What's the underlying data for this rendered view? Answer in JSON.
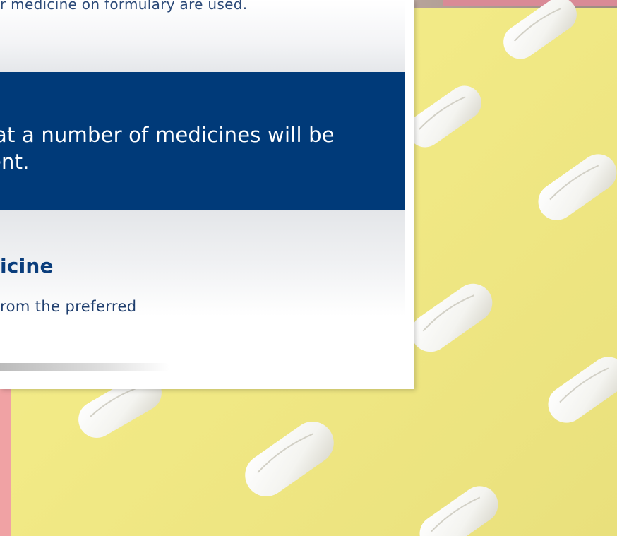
{
  "card": {
    "top_text": "r medicine on formulary are used.",
    "notice_line_1": "at a number of medicines will be",
    "notice_line_2": "ent.",
    "section_heading": "icine",
    "section_body": "rom the preferred"
  },
  "colors": {
    "notice_background": "#003a79",
    "heading_text": "#0a3d7c",
    "background_yellow": "#f2ea86",
    "accent_pink": "#f0a2a4"
  },
  "background": {
    "image": "white-pills-on-yellow"
  }
}
